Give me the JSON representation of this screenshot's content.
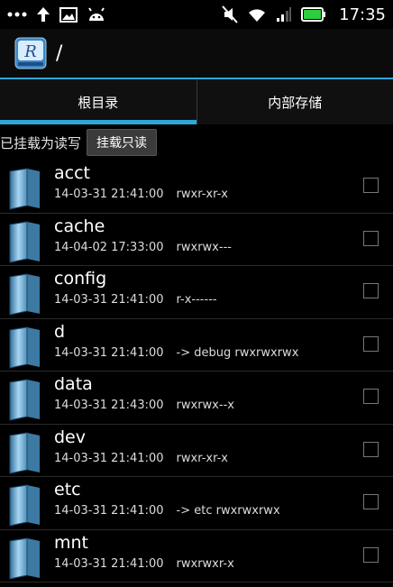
{
  "status_bar": {
    "time": "17:35",
    "icons": [
      "more-dots-icon",
      "upload-arrow-icon",
      "image-icon",
      "android-icon",
      "mute-icon",
      "wifi-icon",
      "signal-icon",
      "battery-icon"
    ],
    "battery_color": "#2ecc40"
  },
  "header": {
    "path": "/",
    "logo_letter": "R"
  },
  "tabs": [
    {
      "label": "根目录",
      "active": true
    },
    {
      "label": "内部存储",
      "active": false
    }
  ],
  "mount": {
    "status": "已挂载为读写",
    "button": "挂载只读"
  },
  "accent_color": "#2ea6d8",
  "files": [
    {
      "name": "acct",
      "date": "14-03-31 21:41:00",
      "link": "",
      "perms": "rwxr-xr-x"
    },
    {
      "name": "cache",
      "date": "14-04-02 17:33:00",
      "link": "",
      "perms": "rwxrwx---"
    },
    {
      "name": "config",
      "date": "14-03-31 21:41:00",
      "link": "",
      "perms": "r-x------"
    },
    {
      "name": "d",
      "date": "14-03-31 21:41:00",
      "link": "-> debug",
      "perms": "rwxrwxrwx"
    },
    {
      "name": "data",
      "date": "14-03-31 21:43:00",
      "link": "",
      "perms": "rwxrwx--x"
    },
    {
      "name": "dev",
      "date": "14-03-31 21:41:00",
      "link": "",
      "perms": "rwxr-xr-x"
    },
    {
      "name": "etc",
      "date": "14-03-31 21:41:00",
      "link": "-> etc",
      "perms": "rwxrwxrwx"
    },
    {
      "name": "mnt",
      "date": "14-03-31 21:41:00",
      "link": "",
      "perms": "rwxrwxr-x"
    }
  ]
}
